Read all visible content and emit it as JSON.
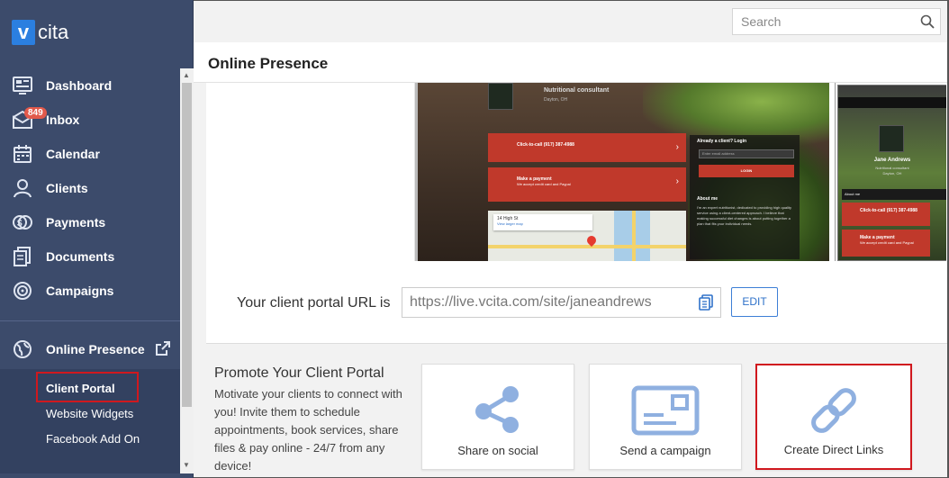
{
  "app": {
    "logo_v": "v",
    "logo_text": "cita"
  },
  "sidebar": {
    "items": [
      {
        "label": "Dashboard",
        "icon": "dashboard-icon"
      },
      {
        "label": "Inbox",
        "icon": "inbox-icon",
        "badge": "849"
      },
      {
        "label": "Calendar",
        "icon": "calendar-icon"
      },
      {
        "label": "Clients",
        "icon": "clients-icon"
      },
      {
        "label": "Payments",
        "icon": "payments-icon"
      },
      {
        "label": "Documents",
        "icon": "documents-icon"
      },
      {
        "label": "Campaigns",
        "icon": "campaigns-icon"
      }
    ],
    "online_presence": {
      "label": "Online Presence",
      "icon": "globe-icon"
    },
    "subitems": [
      "Client Portal",
      "Website Widgets",
      "Facebook Add On"
    ]
  },
  "search": {
    "placeholder": "Search"
  },
  "page": {
    "title": "Online Presence"
  },
  "preview": {
    "business_title": "Nutritional consultant",
    "business_location": "Dayton, OH",
    "call_button": "Click-to-call (917) 387-4988",
    "payment_button": "Make a payment",
    "payment_sub": "We accept credit card and Paypal",
    "login_title": "Already a client? Login",
    "login_placeholder": "Enter email address",
    "login_button": "LOGIN",
    "about_title": "About me",
    "about_text": "I'm an expert nutritionist, dedicated to providing high quality service using a client-centered approach. I believe that making successful diet changes is about putting together a plan that fits your individual needs.",
    "map_address": "14 High St",
    "map_link": "View larger map",
    "phone_name": "Jane Andrews",
    "phone_title": "Nutritional consultant",
    "phone_location": "Dayton, OH",
    "phone_about": "About me",
    "phone_call": "Click-to-call (917) 387-4988",
    "phone_payment": "Make a payment",
    "phone_payment_sub": "We accept credit card and Paypal"
  },
  "portal": {
    "url_label": "Your client portal URL is",
    "url_value": "https://live.vcita.com/site/janeandrews",
    "edit_label": "EDIT"
  },
  "promote": {
    "title": "Promote Your Client Portal",
    "text": "Motivate your clients to connect with you! Invite them to schedule appointments, book services, share files & pay online - 24/7 from any device!",
    "tiles": [
      {
        "label": "Share on social",
        "icon": "share-icon"
      },
      {
        "label": "Send a campaign",
        "icon": "envelope-icon"
      },
      {
        "label": "Create Direct Links",
        "icon": "link-icon"
      }
    ]
  },
  "colors": {
    "sidebar": "#3c4b6b",
    "accent": "#2e71c9",
    "highlight": "#d0181e",
    "badge": "#e25a4b",
    "brand_red": "#c0392b"
  }
}
